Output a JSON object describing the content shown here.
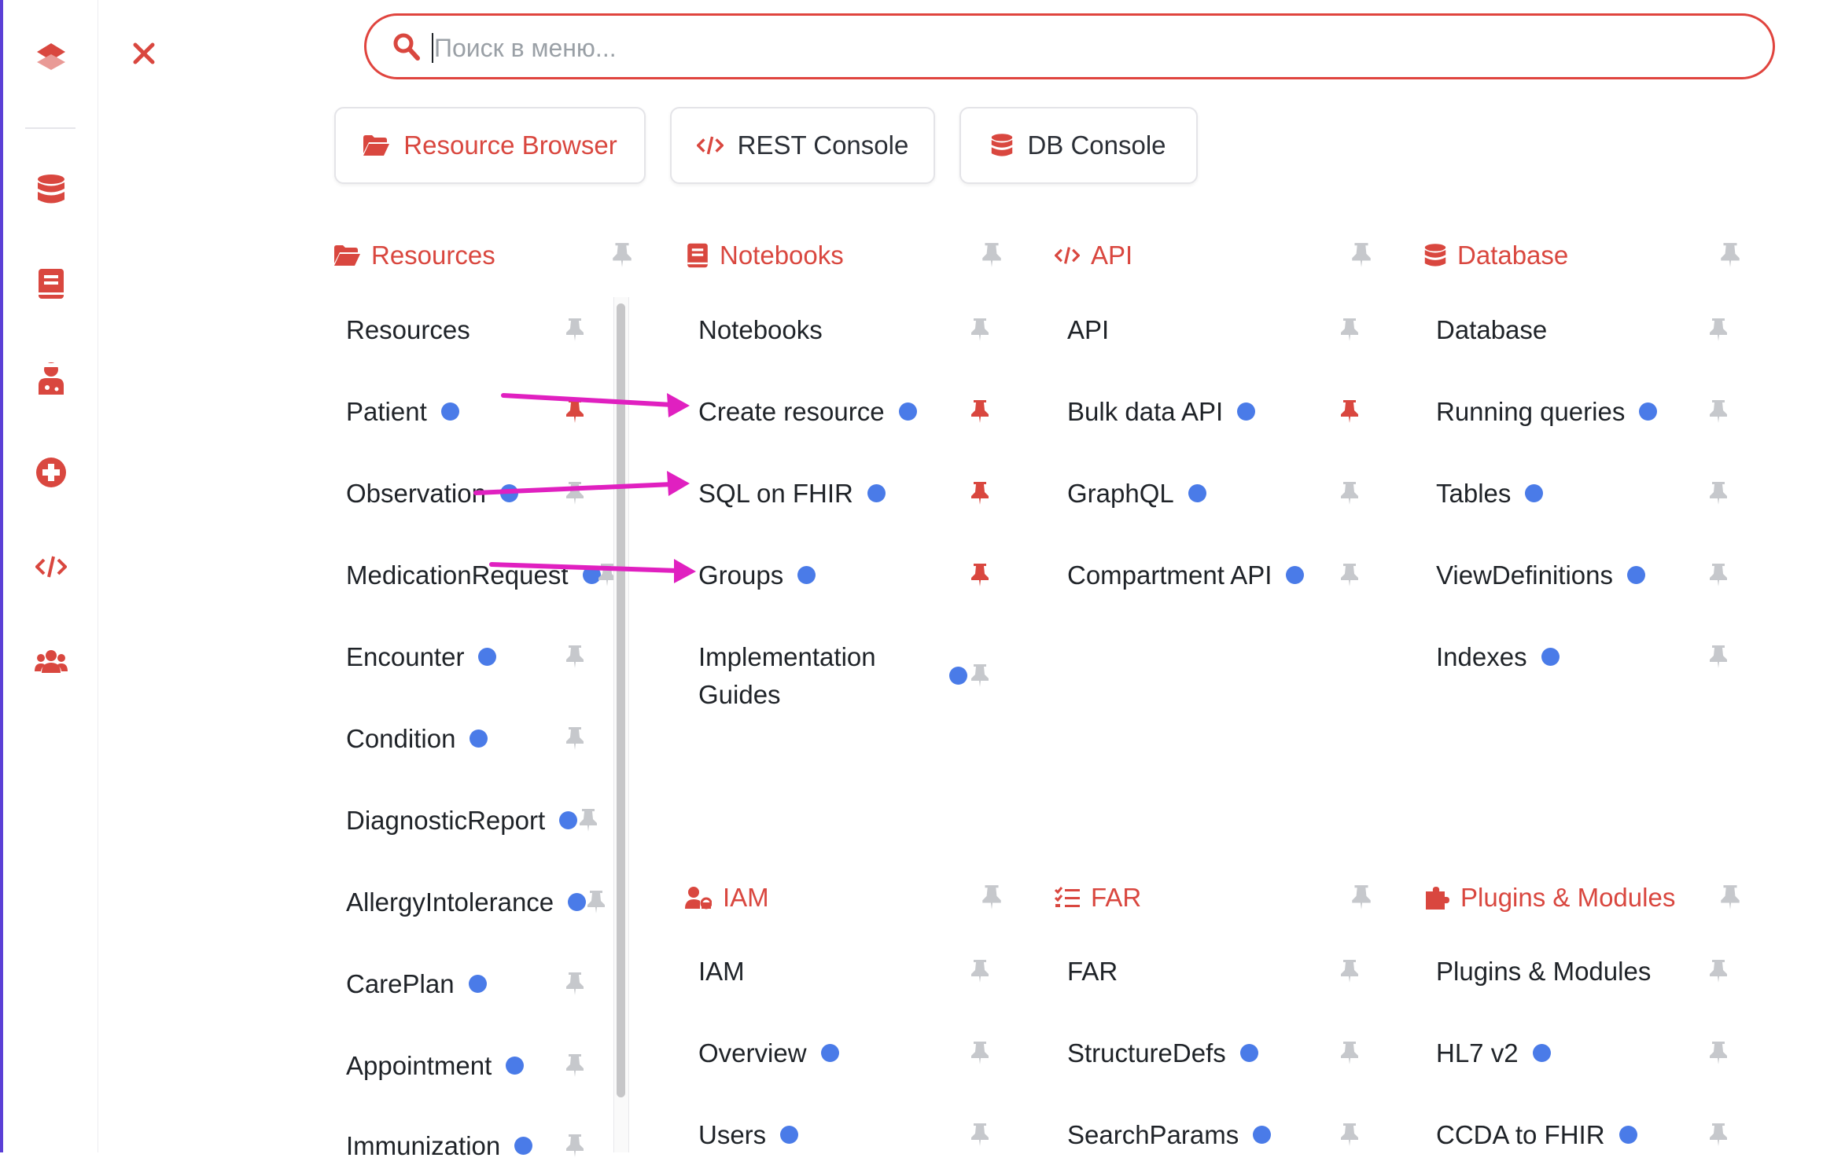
{
  "sidebar": {
    "icons": [
      "layers-icon",
      "database-icon",
      "notebook-icon",
      "doctor-icon",
      "medical-plus-icon",
      "code-icon",
      "users-icon"
    ]
  },
  "search": {
    "placeholder": "Поиск в меню..."
  },
  "quick": {
    "resource_browser": "Resource Browser",
    "rest_console": "REST Console",
    "db_console": "DB Console"
  },
  "colors": {
    "accent": "#d9473f",
    "dot": "#4a7be8",
    "arrow": "#e020c0",
    "sidebar_edge": "#5b3fd6"
  },
  "sections": {
    "resources": {
      "title": "Resources",
      "items": [
        {
          "label": "Resources",
          "dot": false,
          "pinned": false
        },
        {
          "label": "Patient",
          "dot": true,
          "pinned": true
        },
        {
          "label": "Observation",
          "dot": true,
          "pinned": false
        },
        {
          "label": "MedicationRequest",
          "dot": true,
          "pinned": false
        },
        {
          "label": "Encounter",
          "dot": true,
          "pinned": false
        },
        {
          "label": "Condition",
          "dot": true,
          "pinned": false
        },
        {
          "label": "DiagnosticReport",
          "dot": true,
          "pinned": false
        },
        {
          "label": "AllergyIntolerance",
          "dot": true,
          "pinned": false
        },
        {
          "label": "CarePlan",
          "dot": true,
          "pinned": false
        },
        {
          "label": "Appointment",
          "dot": true,
          "pinned": false
        },
        {
          "label": "Immunization",
          "dot": true,
          "pinned": false
        }
      ]
    },
    "notebooks": {
      "title": "Notebooks",
      "items": [
        {
          "label": "Notebooks",
          "dot": false,
          "pinned": false
        },
        {
          "label": "Create resource",
          "dot": true,
          "pinned": true
        },
        {
          "label": "SQL on FHIR",
          "dot": true,
          "pinned": true
        },
        {
          "label": "Groups",
          "dot": true,
          "pinned": true
        },
        {
          "label": "Implementation Guides",
          "dot": true,
          "pinned": false
        }
      ]
    },
    "api": {
      "title": "API",
      "items": [
        {
          "label": "API",
          "dot": false,
          "pinned": false
        },
        {
          "label": "Bulk data API",
          "dot": true,
          "pinned": true
        },
        {
          "label": "GraphQL",
          "dot": true,
          "pinned": false
        },
        {
          "label": "Compartment API",
          "dot": true,
          "pinned": false
        }
      ]
    },
    "database": {
      "title": "Database",
      "items": [
        {
          "label": "Database",
          "dot": false,
          "pinned": false
        },
        {
          "label": "Running queries",
          "dot": true,
          "pinned": false
        },
        {
          "label": "Tables",
          "dot": true,
          "pinned": false
        },
        {
          "label": "ViewDefinitions",
          "dot": true,
          "pinned": false
        },
        {
          "label": "Indexes",
          "dot": true,
          "pinned": false
        }
      ]
    },
    "iam": {
      "title": "IAM",
      "items": [
        {
          "label": "IAM",
          "dot": false,
          "pinned": false
        },
        {
          "label": "Overview",
          "dot": true,
          "pinned": false
        },
        {
          "label": "Users",
          "dot": true,
          "pinned": false
        }
      ]
    },
    "far": {
      "title": "FAR",
      "items": [
        {
          "label": "FAR",
          "dot": false,
          "pinned": false
        },
        {
          "label": "StructureDefs",
          "dot": true,
          "pinned": false
        },
        {
          "label": "SearchParams",
          "dot": true,
          "pinned": false
        }
      ]
    },
    "plugins": {
      "title": "Plugins & Modules",
      "items": [
        {
          "label": "Plugins & Modules",
          "dot": false,
          "pinned": false
        },
        {
          "label": "HL7 v2",
          "dot": true,
          "pinned": false
        },
        {
          "label": "CCDA to FHIR",
          "dot": true,
          "pinned": false
        }
      ]
    }
  }
}
